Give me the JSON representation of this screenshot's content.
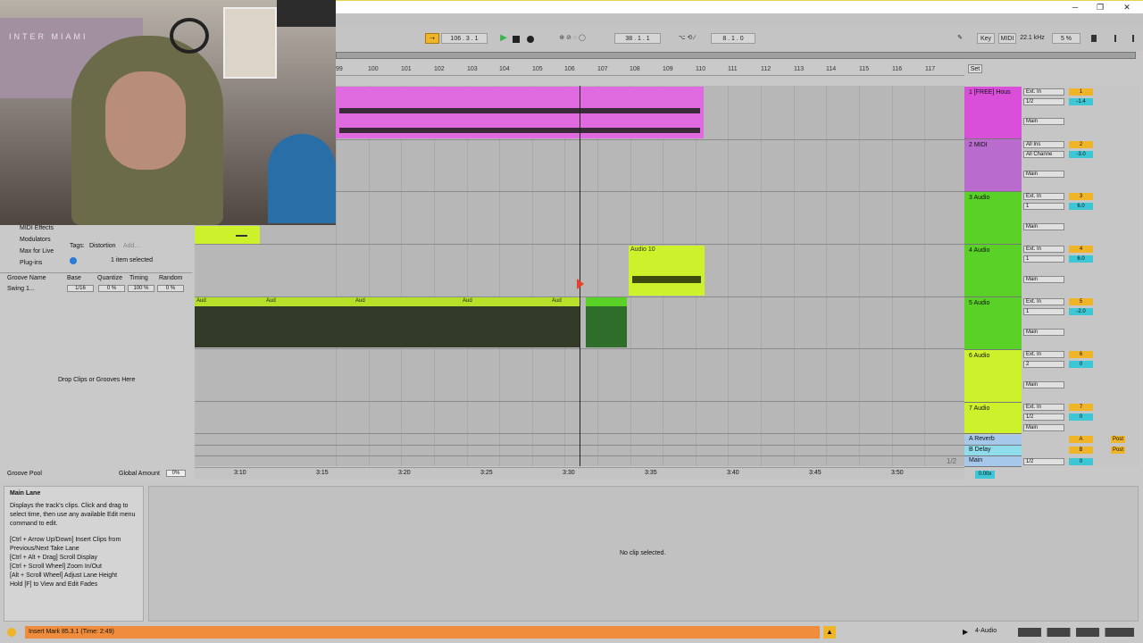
{
  "window": {
    "minimize": "─",
    "restore": "❐",
    "close": "✕"
  },
  "transport": {
    "tempo": "106 .  3 .  1",
    "position": "38 .  1 .  1",
    "loop_length": "8 .  1 .  0"
  },
  "top_right": {
    "key": "Key",
    "midi": "MIDI",
    "sample_rate": "22.1 kHz",
    "cpu": "5 %"
  },
  "ruler": {
    "bars": [
      "99",
      "100",
      "101",
      "102",
      "103",
      "104",
      "105",
      "106",
      "107",
      "108",
      "109",
      "110",
      "111",
      "112",
      "113",
      "114",
      "115",
      "116",
      "117"
    ],
    "set_label": "Set"
  },
  "tracks": [
    {
      "name": "1 [FREE] Hous",
      "color": "#d94fd9",
      "input": "Ext. In",
      "channel": "1/2",
      "number": "1",
      "volume": "-1.4",
      "pan": "C",
      "send": "-∞",
      "output": "Main"
    },
    {
      "name": "2 MIDI",
      "color": "#b96ccd",
      "input": "All Ins",
      "channel": "All Channe",
      "number": "2",
      "volume": "-3.0",
      "pan": "C",
      "send": "-∞",
      "output": "Main"
    },
    {
      "name": "3 Audio",
      "color": "#59d126",
      "input": "Ext. In",
      "channel": "1",
      "number": "3",
      "volume": "6.0",
      "pan": "C",
      "send": "-∞",
      "output": "Main"
    },
    {
      "name": "4 Audio",
      "color": "#59d126",
      "input": "Ext. In",
      "channel": "1",
      "number": "4",
      "volume": "6.0",
      "pan": "C",
      "send": "-∞",
      "output": "Main"
    },
    {
      "name": "5 Audio",
      "color": "#59d126",
      "input": "Ext. In",
      "channel": "1",
      "number": "5",
      "volume": "-2.0",
      "pan": "C",
      "send": "-∞",
      "output": "Main"
    },
    {
      "name": "6 Audio",
      "color": "#cdf22c",
      "input": "Ext. In",
      "channel": "2",
      "number": "6",
      "volume": "0",
      "pan": "C",
      "send": "-∞",
      "output": "Main"
    },
    {
      "name": "7 Audio",
      "color": "#cdf22c",
      "input": "Ext. In",
      "channel": "1/2",
      "number": "7",
      "volume": "0",
      "pan": "C",
      "send": "-∞",
      "output": "Main"
    }
  ],
  "returns": [
    {
      "name": "A Reverb",
      "letter": "A",
      "post": "Post"
    },
    {
      "name": "B Delay",
      "letter": "B",
      "post": "Post"
    },
    {
      "name": "Main",
      "channel": "1/2",
      "volume": "0"
    }
  ],
  "monitor": {
    "in": "In",
    "auto": "Auto",
    "off": "Off",
    "solo": "S"
  },
  "clips": {
    "audio10": "Audio 10",
    "aud": "Aud"
  },
  "time_ticks": [
    "3:10",
    "3:15",
    "3:20",
    "3:25",
    "3:30",
    "3:35",
    "3:40",
    "3:45",
    "3:50"
  ],
  "fraction": "1/2",
  "zoom": "0.00x",
  "browser": {
    "items": [
      "MIDI Effects",
      "Modulators",
      "Max for Live",
      "Plug-ins"
    ],
    "tags_label": "Tags:",
    "tag": "Distortion",
    "add": "Add...",
    "selected": "1 item selected",
    "groove_headers": [
      "Groove Name",
      "Base",
      "Quantize",
      "Timing",
      "Random"
    ],
    "groove_row": [
      "Swing 1...",
      "1/16",
      "0 %",
      "100 %",
      "0 %"
    ],
    "drop_hint": "Drop Clips or Grooves Here",
    "groove_pool": "Groove Pool",
    "global_amount": "Global Amount",
    "global_value": "0%"
  },
  "info": {
    "title": "Main Lane",
    "body": "Displays the track's clips. Click and drag to select time, then use any available Edit menu command to edit.",
    "shortcuts": [
      "[Ctrl + Arrow Up/Down] Insert Clips from Previous/Next Take Lane",
      "[Ctrl + Alt + Drag] Scroll Display",
      "[Ctrl + Scroll Wheel] Zoom In/Out",
      "[Alt + Scroll Wheel] Adjust Lane Height",
      "Hold [F] to View and Edit Fades"
    ]
  },
  "detail": {
    "empty": "No clip selected."
  },
  "status": {
    "message": "Insert Mark 85.3.1 (Time: 2:49)",
    "track": "4-Audio"
  },
  "webcam": {
    "sign_text": "INTER MIAMI"
  }
}
